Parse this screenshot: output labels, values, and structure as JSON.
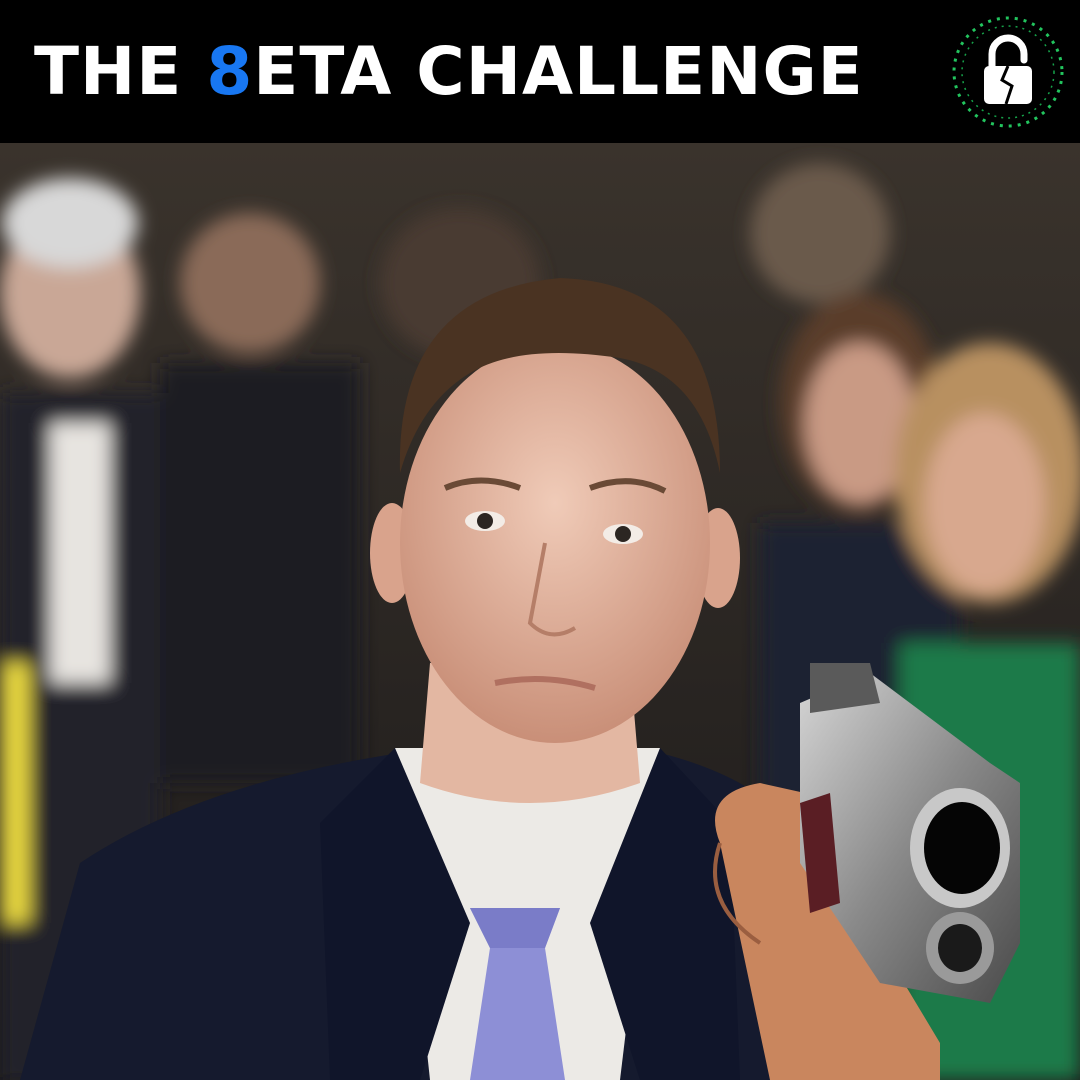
{
  "banner": {
    "title_prefix": "THE ",
    "title_accent": "8",
    "title_suffix": "ETA CHALLENGE",
    "accent_color": "#1877f2",
    "logo_icon": "broken-lock-icon",
    "logo_ring_color": "#22c55e"
  },
  "photo": {
    "icon": "photo-man-with-handgun",
    "background": "blurred seated crowd"
  }
}
